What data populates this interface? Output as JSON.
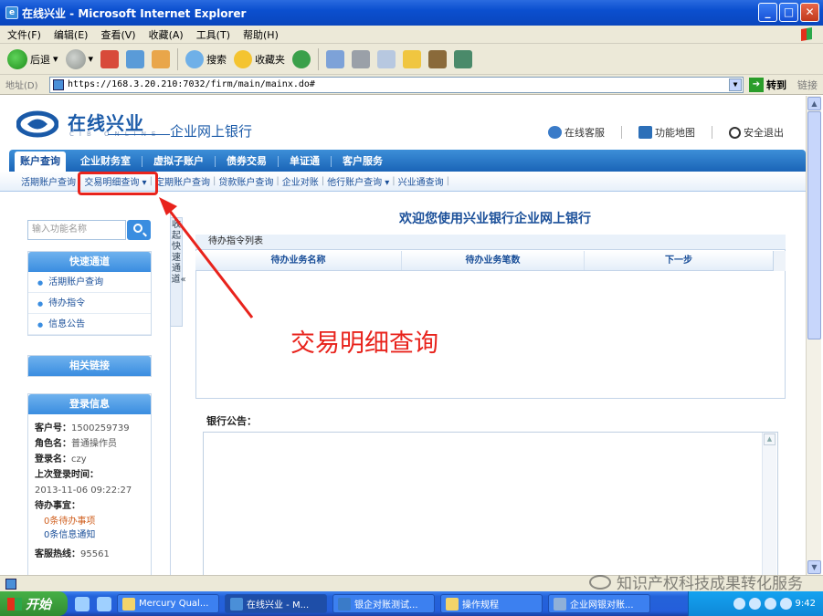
{
  "window": {
    "title": "在线兴业 - Microsoft Internet Explorer",
    "controls": [
      "minimize-icon",
      "maximize-icon",
      "close-icon"
    ]
  },
  "menubar": {
    "items": [
      "文件(F)",
      "编辑(E)",
      "查看(V)",
      "收藏(A)",
      "工具(T)",
      "帮助(H)"
    ]
  },
  "toolbar": {
    "back_label": "后退",
    "search_label": "搜索",
    "favorites_label": "收藏夹"
  },
  "address": {
    "label": "地址(D)",
    "url": "https://168.3.20.210:7032/firm/main/mainx.do#",
    "go_label": "转到",
    "links_label": "链接"
  },
  "bank": {
    "logo_cn": "在线兴业",
    "logo_en": "CIB ONLINE",
    "subtitle": "企业网上银行",
    "header_links": [
      {
        "label": "在线客服",
        "icon": "customer-service-icon"
      },
      {
        "label": "功能地图",
        "icon": "map-icon"
      },
      {
        "label": "安全退出",
        "icon": "power-icon"
      }
    ]
  },
  "main_nav": {
    "tabs": [
      "账户查询",
      "企业财务室",
      "虚拟子账户",
      "债券交易",
      "单证通",
      "客户服务"
    ],
    "active": "账户查询"
  },
  "sub_nav": {
    "items": [
      "活期账户查询",
      "交易明细查询 ▾",
      "定期账户查询",
      "贷款账户查询",
      "企业对账",
      "他行账户查询 ▾",
      "兴业通查询"
    ]
  },
  "sidebar": {
    "search_placeholder": "输入功能名称",
    "quick_title": "快速通道",
    "quick_items": [
      "活期账户查询",
      "待办指令",
      "信息公告"
    ],
    "links_title": "相关链接",
    "login_title": "登录信息",
    "login": {
      "customer_no_label": "客户号：",
      "customer_no": "1500259739",
      "role_label": "角色名：",
      "role": "普通操作员",
      "login_name_label": "登录名：",
      "login_name": "czy",
      "last_login_label": "上次登录时间：",
      "last_login": "2013-11-06 09:22:27",
      "todo_label": "待办事宜：",
      "todo_count_text": "0条待办事项",
      "info_count_text": "0条信息通知",
      "hotline_label": "客服热线：",
      "hotline": "95561"
    }
  },
  "quick_strip": {
    "text": "收起快速通道«"
  },
  "main": {
    "welcome": "欢迎您使用兴业银行企业网上银行",
    "todo_title": "待办指令列表",
    "todo_columns": [
      "待办业务名称",
      "待办业务笔数",
      "下一步"
    ],
    "notice_label": "银行公告："
  },
  "annotation": {
    "label": "交易明细查询",
    "color": "#e8231c"
  },
  "watermark": "知识产权科技成果转化服务",
  "taskbar": {
    "start_label": "开始",
    "tasks": [
      "Mercury Qual...",
      "在线兴业 - M...",
      "银企对账测试...",
      "操作规程",
      "企业网银对账..."
    ],
    "clock": "9:42"
  },
  "colors": {
    "brand_blue": "#1a5aa8",
    "nav_blue": "#2a78c8",
    "annotation_red": "#e8231c"
  }
}
